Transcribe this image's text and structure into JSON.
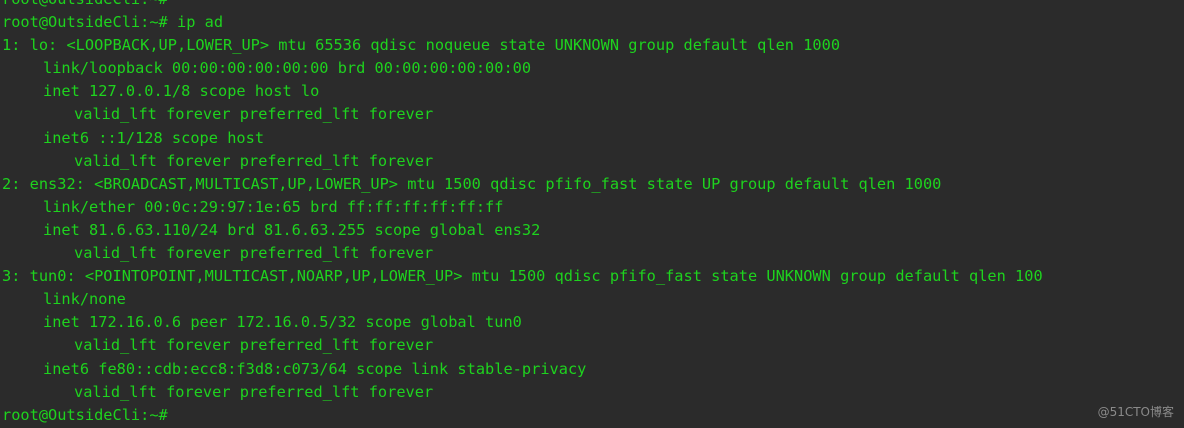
{
  "terminal": {
    "colors": {
      "background": "#2b2b2b",
      "foreground": "#1ed31e"
    },
    "lines": [
      "root@OutsideCli:~#",
      "root@OutsideCli:~# ip ad",
      "1: lo: <LOOPBACK,UP,LOWER_UP> mtu 65536 qdisc noqueue state UNKNOWN group default qlen 1000",
      "link/loopback 00:00:00:00:00:00 brd 00:00:00:00:00:00",
      "inet 127.0.0.1/8 scope host lo",
      "valid_lft forever preferred_lft forever",
      "inet6 ::1/128 scope host",
      "valid_lft forever preferred_lft forever",
      "2: ens32: <BROADCAST,MULTICAST,UP,LOWER_UP> mtu 1500 qdisc pfifo_fast state UP group default qlen 1000",
      "link/ether 00:0c:29:97:1e:65 brd ff:ff:ff:ff:ff:ff",
      "inet 81.6.63.110/24 brd 81.6.63.255 scope global ens32",
      "valid_lft forever preferred_lft forever",
      "3: tun0: <POINTOPOINT,MULTICAST,NOARP,UP,LOWER_UP> mtu 1500 qdisc pfifo_fast state UNKNOWN group default qlen 100",
      "link/none",
      "inet 172.16.0.6 peer 172.16.0.5/32 scope global tun0",
      "valid_lft forever preferred_lft forever",
      "inet6 fe80::cdb:ecc8:f3d8:c073/64 scope link stable-privacy",
      "valid_lft forever preferred_lft forever",
      "root@OutsideCli:~#"
    ]
  },
  "watermark": "@51CTO博客"
}
